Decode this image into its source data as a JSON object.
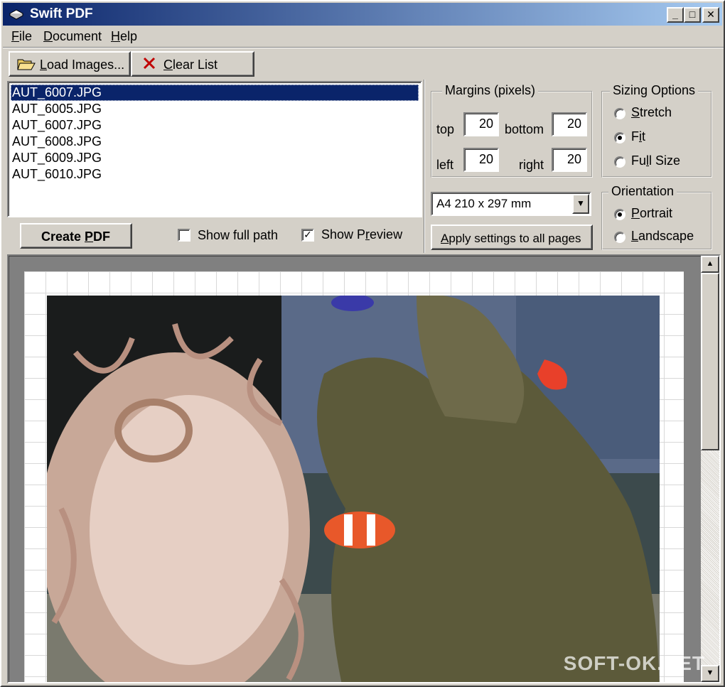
{
  "window": {
    "title": "Swift PDF",
    "controls": [
      "_",
      "□",
      "✕"
    ]
  },
  "menu": {
    "items": [
      {
        "label": "File",
        "mnemonic": "F",
        "rest": "ile"
      },
      {
        "label": "Document",
        "mnemonic": "D",
        "rest": "ocument"
      },
      {
        "label": "Help",
        "mnemonic": "H",
        "rest": "elp"
      }
    ]
  },
  "toolbar": {
    "load": {
      "mnemonic": "L",
      "rest": "oad Images...",
      "icon": "folder-open-icon"
    },
    "clear": {
      "mnemonic": "C",
      "rest": "lear List",
      "icon": "red-x-icon"
    }
  },
  "files": {
    "selected_index": 0,
    "items": [
      "AUT_6007.JPG",
      "AUT_6005.JPG",
      "AUT_6007.JPG",
      "AUT_6008.JPG",
      "AUT_6009.JPG",
      "AUT_6010.JPG"
    ]
  },
  "actions": {
    "create_pdf": {
      "pre": "Create ",
      "mnemonic": "P",
      "post": "DF"
    },
    "show_full_path": {
      "label": "Show full path",
      "checked": false
    },
    "show_preview": {
      "pre": "Show P",
      "mnemonic": "r",
      "post": "eview",
      "checked": true
    }
  },
  "margins": {
    "legend": "Margins (pixels)",
    "top": {
      "label": "top",
      "value": "20"
    },
    "bottom": {
      "label": "bottom",
      "value": "20"
    },
    "left": {
      "label": "left",
      "value": "20"
    },
    "right": {
      "label": "right",
      "value": "20"
    }
  },
  "sizing": {
    "legend": "Sizing Options",
    "options": [
      {
        "mnemonic": "S",
        "rest": "tretch",
        "checked": false
      },
      {
        "pre": "F",
        "mnemonic": "i",
        "rest": "t",
        "checked": true
      },
      {
        "pre": "Fu",
        "mnemonic": "l",
        "rest": "l Size",
        "checked": false
      }
    ]
  },
  "page_size": {
    "value": "A4 210 x 297 mm"
  },
  "apply": {
    "mnemonic": "A",
    "rest": "pply settings to all pages"
  },
  "orientation": {
    "legend": "Orientation",
    "options": [
      {
        "mnemonic": "P",
        "rest": "ortrait",
        "checked": true
      },
      {
        "mnemonic": "L",
        "rest": "andscape",
        "checked": false
      }
    ]
  },
  "watermark": "SOFT-OK.NET",
  "colors": {
    "title_start": "#0a246a",
    "title_end": "#a6caf0",
    "face": "#d4d0c8",
    "selection": "#0a246a"
  }
}
